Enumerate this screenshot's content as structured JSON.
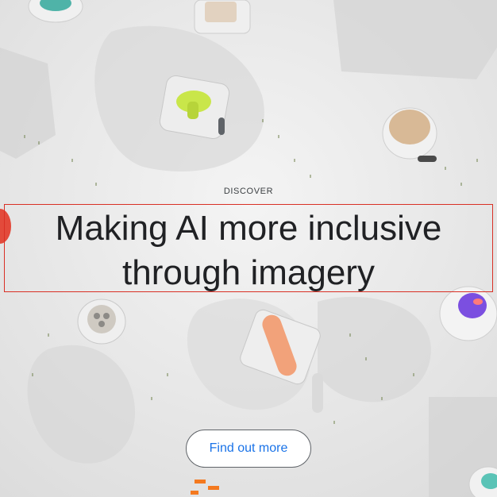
{
  "hero": {
    "eyebrow": "DISCOVER",
    "headline_line1": "Making AI more inclusive",
    "headline_line2": "through imagery",
    "cta_label": "Find out more"
  },
  "colors": {
    "accent": "#1a73e8",
    "text": "#202124",
    "selection_outline": "#d93025"
  }
}
